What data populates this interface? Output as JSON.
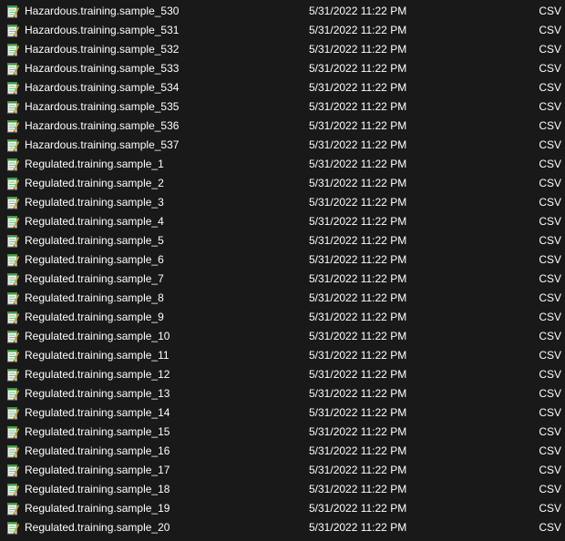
{
  "icon_name": "csv-file-icon",
  "files": [
    {
      "name": "Hazardous.training.sample_530",
      "date": "5/31/2022 11:22 PM",
      "type": "CSV"
    },
    {
      "name": "Hazardous.training.sample_531",
      "date": "5/31/2022 11:22 PM",
      "type": "CSV"
    },
    {
      "name": "Hazardous.training.sample_532",
      "date": "5/31/2022 11:22 PM",
      "type": "CSV"
    },
    {
      "name": "Hazardous.training.sample_533",
      "date": "5/31/2022 11:22 PM",
      "type": "CSV"
    },
    {
      "name": "Hazardous.training.sample_534",
      "date": "5/31/2022 11:22 PM",
      "type": "CSV"
    },
    {
      "name": "Hazardous.training.sample_535",
      "date": "5/31/2022 11:22 PM",
      "type": "CSV"
    },
    {
      "name": "Hazardous.training.sample_536",
      "date": "5/31/2022 11:22 PM",
      "type": "CSV"
    },
    {
      "name": "Hazardous.training.sample_537",
      "date": "5/31/2022 11:22 PM",
      "type": "CSV"
    },
    {
      "name": "Regulated.training.sample_1",
      "date": "5/31/2022 11:22 PM",
      "type": "CSV"
    },
    {
      "name": "Regulated.training.sample_2",
      "date": "5/31/2022 11:22 PM",
      "type": "CSV"
    },
    {
      "name": "Regulated.training.sample_3",
      "date": "5/31/2022 11:22 PM",
      "type": "CSV"
    },
    {
      "name": "Regulated.training.sample_4",
      "date": "5/31/2022 11:22 PM",
      "type": "CSV"
    },
    {
      "name": "Regulated.training.sample_5",
      "date": "5/31/2022 11:22 PM",
      "type": "CSV"
    },
    {
      "name": "Regulated.training.sample_6",
      "date": "5/31/2022 11:22 PM",
      "type": "CSV"
    },
    {
      "name": "Regulated.training.sample_7",
      "date": "5/31/2022 11:22 PM",
      "type": "CSV"
    },
    {
      "name": "Regulated.training.sample_8",
      "date": "5/31/2022 11:22 PM",
      "type": "CSV"
    },
    {
      "name": "Regulated.training.sample_9",
      "date": "5/31/2022 11:22 PM",
      "type": "CSV"
    },
    {
      "name": "Regulated.training.sample_10",
      "date": "5/31/2022 11:22 PM",
      "type": "CSV"
    },
    {
      "name": "Regulated.training.sample_11",
      "date": "5/31/2022 11:22 PM",
      "type": "CSV"
    },
    {
      "name": "Regulated.training.sample_12",
      "date": "5/31/2022 11:22 PM",
      "type": "CSV"
    },
    {
      "name": "Regulated.training.sample_13",
      "date": "5/31/2022 11:22 PM",
      "type": "CSV"
    },
    {
      "name": "Regulated.training.sample_14",
      "date": "5/31/2022 11:22 PM",
      "type": "CSV"
    },
    {
      "name": "Regulated.training.sample_15",
      "date": "5/31/2022 11:22 PM",
      "type": "CSV"
    },
    {
      "name": "Regulated.training.sample_16",
      "date": "5/31/2022 11:22 PM",
      "type": "CSV"
    },
    {
      "name": "Regulated.training.sample_17",
      "date": "5/31/2022 11:22 PM",
      "type": "CSV"
    },
    {
      "name": "Regulated.training.sample_18",
      "date": "5/31/2022 11:22 PM",
      "type": "CSV"
    },
    {
      "name": "Regulated.training.sample_19",
      "date": "5/31/2022 11:22 PM",
      "type": "CSV"
    },
    {
      "name": "Regulated.training.sample_20",
      "date": "5/31/2022 11:22 PM",
      "type": "CSV"
    }
  ]
}
